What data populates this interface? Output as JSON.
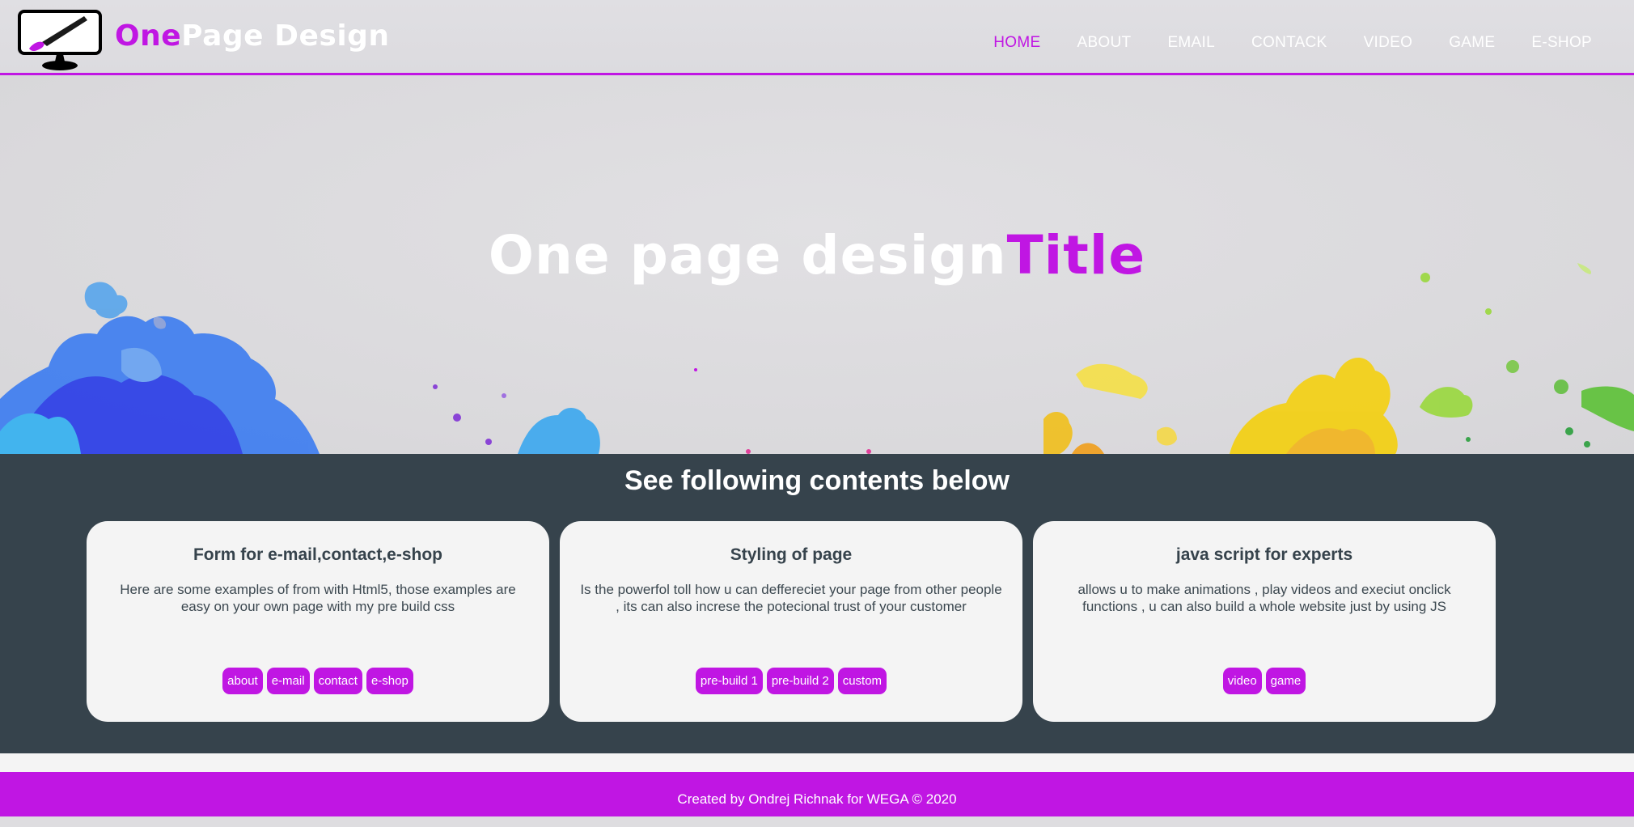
{
  "colors": {
    "accent": "#c016e3",
    "dark": "#36434c",
    "card_bg": "#f4f4f4",
    "header_bg": "#dedde0"
  },
  "header": {
    "logo_icon": "monitor-paintbrush-icon",
    "brand_part1": "One",
    "brand_part2": "Page Design",
    "nav": [
      {
        "label": "HOME",
        "active": true
      },
      {
        "label": "ABOUT",
        "active": false
      },
      {
        "label": "EMAIL",
        "active": false
      },
      {
        "label": "CONTACK",
        "active": false
      },
      {
        "label": "VIDEO",
        "active": false
      },
      {
        "label": "GAME",
        "active": false
      },
      {
        "label": "E-SHOP",
        "active": false
      }
    ]
  },
  "hero": {
    "title_part1": "One page design",
    "title_part2": "Title"
  },
  "section": {
    "heading": "See following contents below",
    "cards": [
      {
        "title": "Form for e-mail,contact,e-shop",
        "text": "Here are some examples of from with Html5, those examples are easy on your own page with my pre build css",
        "buttons": [
          "about",
          "e-mail",
          "contact",
          "e-shop"
        ]
      },
      {
        "title": "Styling of page",
        "text": "Is the powerfol toll how u can deffereciet your page from other people , its can also increse the potecional trust of your customer",
        "buttons": [
          "pre-build 1",
          "pre-build 2",
          "custom"
        ]
      },
      {
        "title": "java script for experts",
        "text": "allows u to make animations , play videos and execiut onclick functions , u can also build a whole website just by using JS",
        "buttons": [
          "video",
          "game"
        ]
      }
    ]
  },
  "footer": {
    "text": "Created by Ondrej Richnak for WEGA © 2020"
  }
}
